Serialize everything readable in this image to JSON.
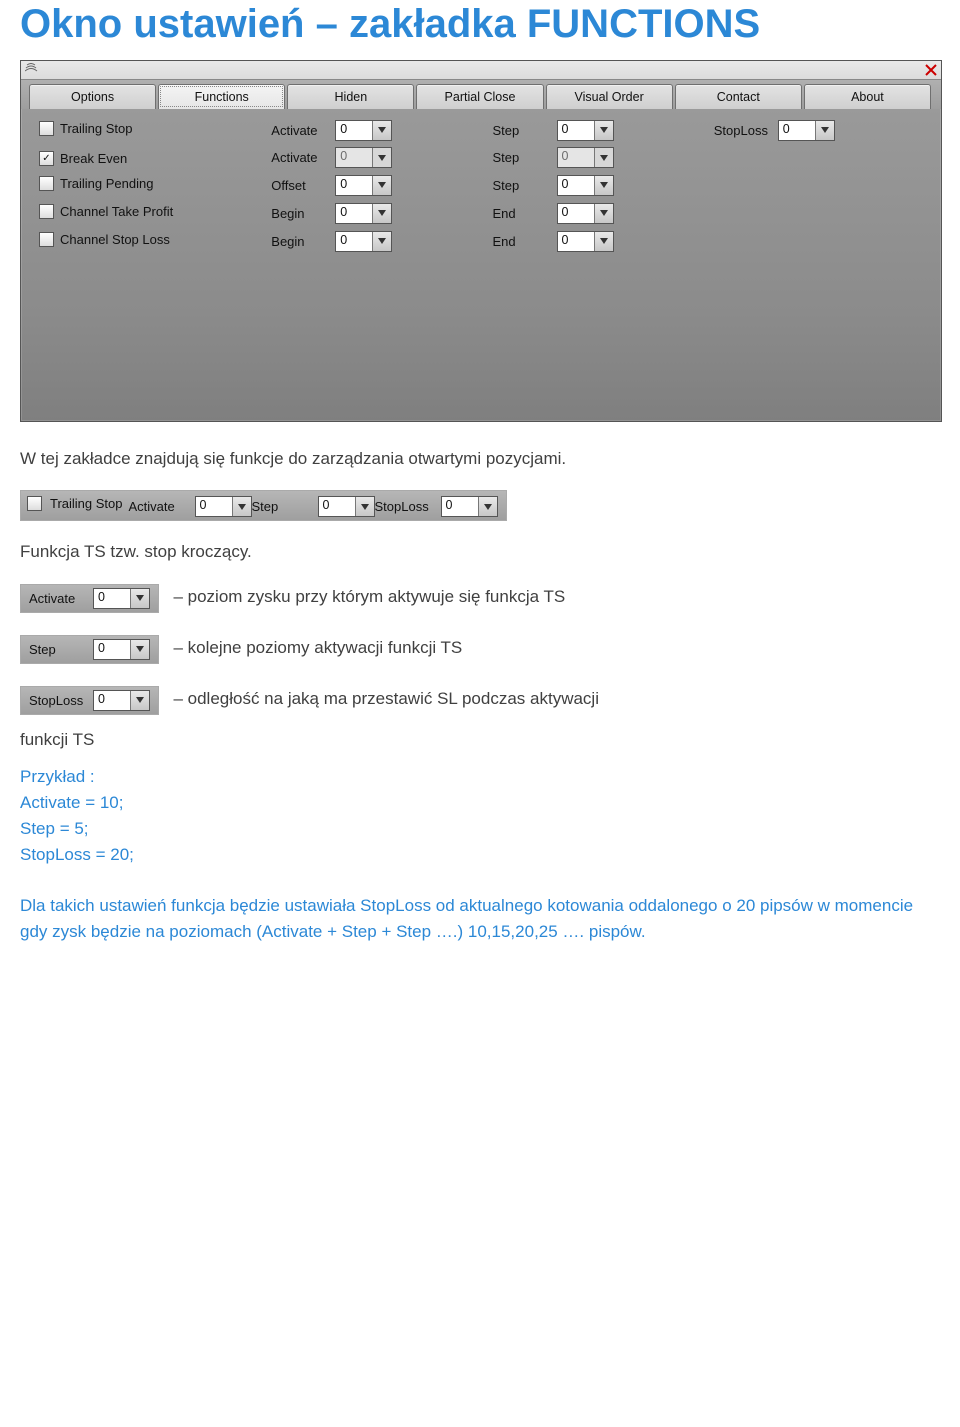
{
  "heading": "Okno ustawień – zakładka FUNCTIONS",
  "tabs": [
    "Options",
    "Functions",
    "Hiden",
    "Partial Close",
    "Visual Order",
    "Contact",
    "About"
  ],
  "active_tab": 1,
  "rows": [
    {
      "check_label": "Trailing Stop",
      "checked": false,
      "fields": [
        {
          "label": "Activate",
          "value": "0",
          "disabled": false
        },
        {
          "label": "Step",
          "value": "0",
          "disabled": false
        },
        {
          "label": "StopLoss",
          "value": "0",
          "disabled": false
        }
      ]
    },
    {
      "check_label": "Break Even",
      "checked": true,
      "fields": [
        {
          "label": "Activate",
          "value": "0",
          "disabled": true
        },
        {
          "label": "Step",
          "value": "0",
          "disabled": true
        }
      ]
    },
    {
      "check_label": "Trailing Pending",
      "checked": false,
      "fields": [
        {
          "label": "Offset",
          "value": "0",
          "disabled": false
        },
        {
          "label": "Step",
          "value": "0",
          "disabled": false
        }
      ]
    },
    {
      "check_label": "Channel Take Profit",
      "checked": false,
      "fields": [
        {
          "label": "Begin",
          "value": "0",
          "disabled": false
        },
        {
          "label": "End",
          "value": "0",
          "disabled": false
        }
      ]
    },
    {
      "check_label": "Channel Stop Loss",
      "checked": false,
      "fields": [
        {
          "label": "Begin",
          "value": "0",
          "disabled": false
        },
        {
          "label": "End",
          "value": "0",
          "disabled": false
        }
      ]
    }
  ],
  "intro_text": "W tej zakładce znajdują się funkcje do zarządzania otwartymi pozycjami.",
  "mini_ts": {
    "check_label": "Trailing Stop",
    "checked": false,
    "fields": [
      {
        "label": "Activate",
        "value": "0"
      },
      {
        "label": "Step",
        "value": "0"
      },
      {
        "label": "StopLoss",
        "value": "0"
      }
    ]
  },
  "ts_line": "Funkcja TS tzw. stop kroczący.",
  "activate_field": {
    "label": "Activate",
    "value": "0"
  },
  "activate_desc": "– poziom zysku przy którym aktywuje się funkcja TS",
  "step_field": {
    "label": "Step",
    "value": "0"
  },
  "step_desc": "– kolejne poziomy aktywacji funkcji TS",
  "stoploss_field": {
    "label": "StopLoss",
    "value": "0"
  },
  "stoploss_desc": "– odległość na jaką ma przestawić SL podczas aktywacji",
  "stoploss_tail": "funkcji TS",
  "example_head": "Przykład :",
  "example_lines": [
    "Activate = 10;",
    "Step = 5;",
    "StopLoss = 20;"
  ],
  "footer": "Dla takich ustawień funkcja będzie ustawiała StopLoss od aktualnego kotowania oddalonego o 20 pipsów w momencie gdy zysk będzie na poziomach (Activate + Step + Step ….) 10,15,20,25 …. pispów."
}
